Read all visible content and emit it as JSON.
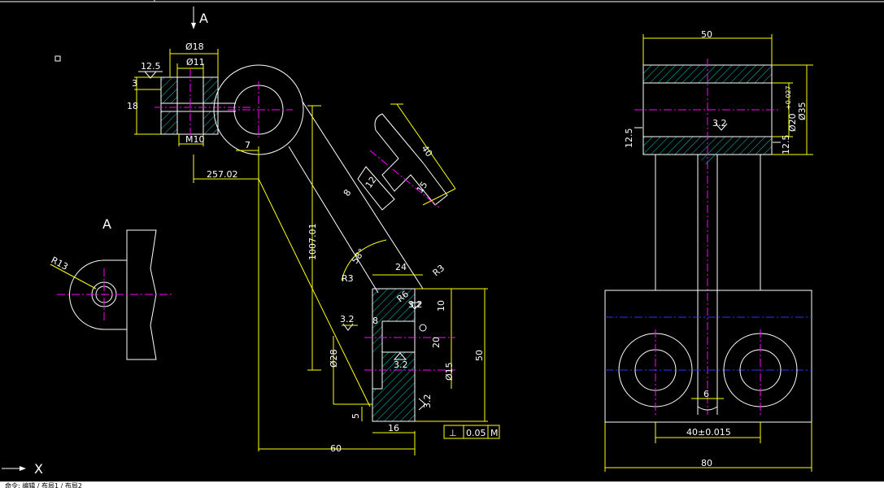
{
  "colors": {
    "background": "#000000",
    "outline": "#ffffff",
    "dimension": "#ffff00",
    "centerline": "#ff00ff",
    "hatch": "#00c8c8",
    "auxline": "#3030ff"
  },
  "view_labels": {
    "top_arrow_label": "A",
    "view_a_label": "A"
  },
  "dims": {
    "d18": "Ø18",
    "d11": "Ø11",
    "m10": "M10",
    "r12_5": "12.5",
    "r3_small": "3",
    "r18": "18",
    "d7": "7",
    "d257": "257.02",
    "d1007": "1007.01",
    "d40": "40",
    "d8": "8",
    "d12": "12",
    "d15": "15",
    "a58": "58°",
    "d24": "24",
    "r3a": "R3",
    "r3b": "R3",
    "r6": "R6",
    "s32a": "3.2",
    "d10": "10",
    "s32b": "3.2",
    "d8b": "8",
    "d20": "20",
    "d28": "Ø28",
    "s32c": "3.2",
    "d15b": "Ø15",
    "d50r": "50",
    "d5": "5",
    "s32d": "3.2",
    "d16": "16",
    "d60": "60",
    "tol_sym": "⊥",
    "tol_val": "0.05",
    "tol_ref": "M",
    "r13": "R13",
    "d50top": "50",
    "d20h7": "Ø20",
    "tol_up": "+0.027",
    "tol_lo": "0",
    "d35": "Ø35",
    "s125a": "12.5",
    "s125b": "12.5",
    "s32e": "3.2",
    "d6": "6",
    "d40b": "40±0.015",
    "d80": "80"
  },
  "ucs_label": "X",
  "status_text": "命令: 编辑 / 布局1 / 布局2"
}
